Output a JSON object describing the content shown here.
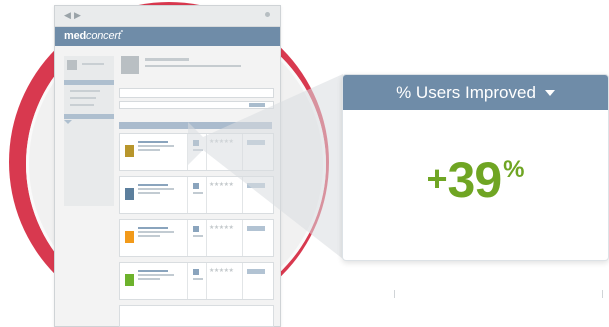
{
  "app": {
    "logo_primary": "med",
    "logo_secondary": "concert",
    "logo_mark": "°"
  },
  "browser": {
    "back_glyph": "◀",
    "forward_glyph": "▶"
  },
  "callout": {
    "title": "% Users Improved",
    "metric_sign": "+",
    "metric_value": "39",
    "metric_unit": "%",
    "accent_color": "#6fa523",
    "header_color": "#6f8ca8"
  },
  "cards": [
    {
      "color": "#b8962c",
      "stars": "★★★★★"
    },
    {
      "color": "#5c7f9d",
      "stars": "★★★★★"
    },
    {
      "color": "#f29a1a",
      "stars": "★★★★★"
    },
    {
      "color": "#6db22c",
      "stars": "★★★★★"
    }
  ],
  "decor": {
    "disc_color": "#d8394f"
  }
}
